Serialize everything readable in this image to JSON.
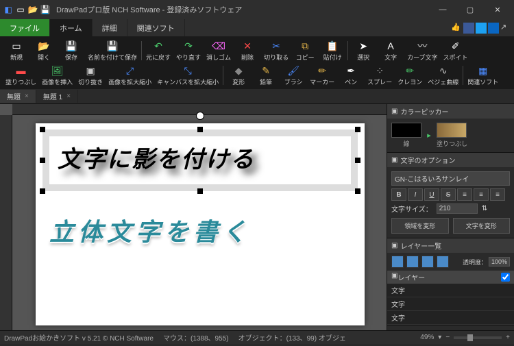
{
  "title": "DrawPadプロ版 NCH Software - 登録済みソフトウェア",
  "menu": {
    "file": "ファイル",
    "home": "ホーム",
    "detail": "詳細",
    "related": "関連ソフト"
  },
  "ribbon": {
    "new": "新規",
    "open": "開く",
    "save": "保存",
    "saveas": "名前を付けて保存",
    "undo": "元に戻す",
    "redo": "やり直す",
    "eraser": "消しゴム",
    "delete": "削除",
    "cut": "切り取る",
    "copy": "コピー",
    "paste": "貼付け",
    "select": "選択",
    "text": "文字",
    "curvetext": "カーブ文字",
    "eyedrop": "スポイト",
    "fill": "塗りつぶし",
    "insertimg": "画像を挿入",
    "crop": "切り抜き",
    "resizeimg": "画像を拡大縮小",
    "resizecanvas": "キャンバスを拡大縮小",
    "transform": "変形",
    "pencil": "鉛筆",
    "brush": "ブラシ",
    "marker": "マーカー",
    "pen": "ペン",
    "spray": "スプレー",
    "crayon": "クレヨン",
    "bezier": "ベジェ曲線",
    "relatedsoft": "関連ソフト"
  },
  "tabs": {
    "t1": "無題",
    "t2": "無題 1"
  },
  "canvas": {
    "text1": "文字に影を付ける",
    "text2": "立体文字を書く"
  },
  "panels": {
    "colorpicker": {
      "title": "カラーピッカー",
      "line": "線",
      "fill": "塗りつぶし"
    },
    "textopt": {
      "title": "文字のオプション",
      "font": "GN-こはるいろサンレイ",
      "sizelabel": "文字サイズ：",
      "size": "210",
      "transformarea": "領域を変形",
      "transformtext": "文字を変形"
    },
    "layers": {
      "title": "レイヤー一覧",
      "opacitylabel": "透明度：",
      "opacity": "100%",
      "header": "レイヤー",
      "items": [
        "文字",
        "文字",
        "文字"
      ]
    }
  },
  "status": {
    "app": "DrawPadお絵かきソフト v 5.21 © NCH Software",
    "mouse": "マウス：(1388、955)",
    "object": "オブジェクト：(133、99) オブジェ",
    "zoom": "49%"
  }
}
